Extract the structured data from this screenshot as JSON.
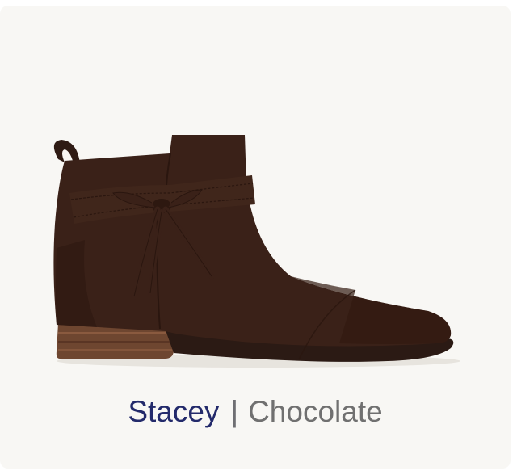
{
  "product": {
    "name": "Stacey",
    "separator": "|",
    "color_name": "Chocolate",
    "image_icon": "ankle-boot-product-image"
  },
  "colors": {
    "card_background": "#f8f7f4",
    "name_color": "#232a6b",
    "color_text": "#707070",
    "boot_suede": "#3a2118",
    "heel_wood": "#6e4630"
  }
}
